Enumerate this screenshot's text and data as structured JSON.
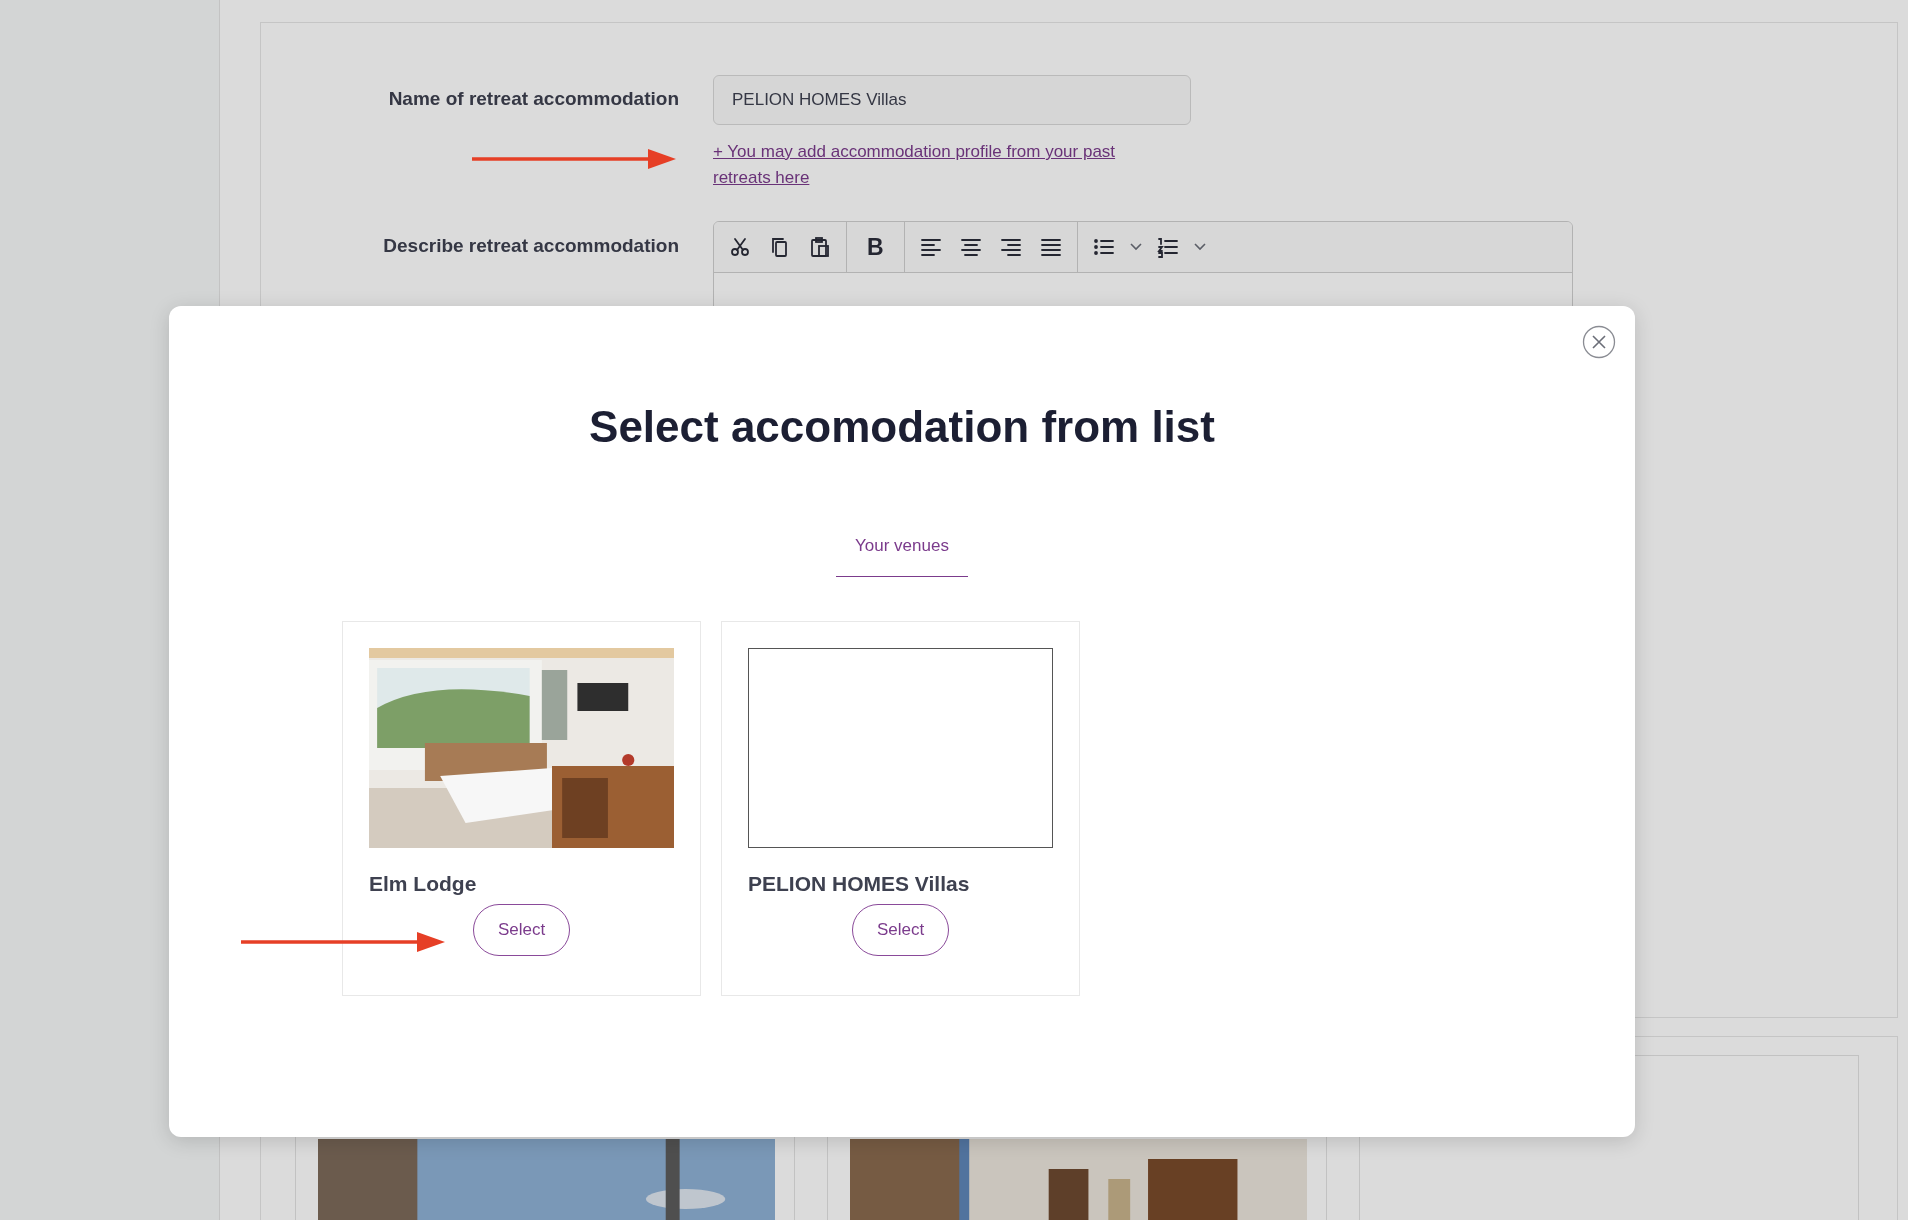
{
  "form": {
    "name_label": "Name of retreat accommodation",
    "name_value": "PELION HOMES Villas",
    "add_link": "+ You may add accommodation profile from your past retreats here",
    "describe_label": "Describe retreat accommodation",
    "toolbar": [
      [
        {
          "kind": "cut"
        },
        {
          "kind": "copy"
        },
        {
          "kind": "paste"
        }
      ],
      [
        {
          "kind": "bold",
          "text": "B"
        }
      ],
      [
        {
          "kind": "align-left"
        },
        {
          "kind": "align-center"
        },
        {
          "kind": "align-right"
        },
        {
          "kind": "justify"
        }
      ],
      [
        {
          "kind": "bullet-list"
        },
        {
          "kind": "dropdown"
        },
        {
          "kind": "numbered-list"
        },
        {
          "kind": "dropdown"
        }
      ]
    ]
  },
  "background_cards": [
    {
      "kind": "picture"
    },
    {
      "kind": "picture"
    },
    {
      "kind": "blank"
    }
  ],
  "modal": {
    "title": "Select accomodation from list",
    "tabs": [
      {
        "label": "Your venues",
        "selected": true
      }
    ],
    "venues": [
      {
        "kind": "picture",
        "name": "Elm Lodge",
        "button": "Select"
      },
      {
        "kind": "blank",
        "name": "PELION HOMES Villas",
        "button": "Select"
      }
    ]
  }
}
